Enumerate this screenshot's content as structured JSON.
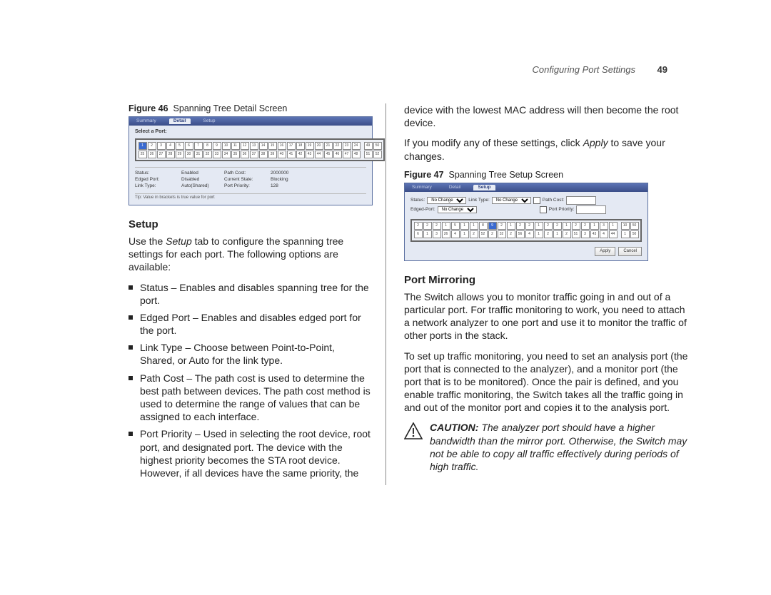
{
  "header": {
    "running_head": "Configuring Port Settings",
    "page_number": "49"
  },
  "left": {
    "fig46_label": "Figure 46",
    "fig46_title": "Spanning Tree Detail Screen",
    "detail_screen": {
      "tab_summary": "Summary",
      "tab_detail": "Detail",
      "tab_setup": "Setup",
      "select_port_label": "Select a Port:",
      "rows": {
        "status_l": "Status:",
        "status_v": "Enabled",
        "pathcost_l": "Path Cost:",
        "pathcost_v": "2000000",
        "edged_l": "Edged Port:",
        "edged_v": "Disabled",
        "curstate_l": "Current State:",
        "curstate_v": "Blocking",
        "linktype_l": "Link Type:",
        "linktype_v": "Auto(Shared)",
        "portprio_l": "Port Priority:",
        "portprio_v": "128"
      },
      "tip": "Tip: Value in brackets is true value for port"
    },
    "setup_heading": "Setup",
    "setup_intro_pre": "Use the ",
    "setup_intro_ital": "Setup",
    "setup_intro_post": " tab to configure the spanning tree settings for each port. The following options are available:",
    "bullets": [
      "Status – Enables and disables spanning tree for the port.",
      "Edged Port – Enables and disables edged port for the port.",
      "Link Type – Choose between Point-to-Point, Shared, or Auto for the link type.",
      "Path Cost – The path cost is used to determine the best path between devices. The path cost method is used to determine the range of values that can be assigned to each interface.",
      "Port Priority – Used in selecting the root device, root port, and designated port. The device with the highest priority becomes the STA root device. However, if all devices have the same priority, the"
    ]
  },
  "right": {
    "continuation": "device with the lowest MAC address will then become the root device.",
    "apply_para_pre": "If you modify any of these settings, click ",
    "apply_para_ital": "Apply",
    "apply_para_post": " to save your changes.",
    "fig47_label": "Figure 47",
    "fig47_title": "Spanning Tree Setup Screen",
    "setup_screen": {
      "tab_summary": "Summary",
      "tab_detail": "Detail",
      "tab_setup": "Setup",
      "status_l": "Status:",
      "status_opt": "No Change",
      "linktype_l": "Link Type:",
      "linktype_opt": "No Change",
      "pathcost_l": "Path Cost:",
      "edged_l": "Edged-Port:",
      "edged_opt": "No Change",
      "portprio_l": "Port Priority:",
      "apply_btn": "Apply",
      "cancel_btn": "Cancel"
    },
    "pm_heading": "Port Mirroring",
    "pm_para1": "The Switch allows you to monitor traffic going in and out of a particular port. For traffic monitoring to work, you need to attach a network analyzer to one port and use it to monitor the traffic of other ports in the stack.",
    "pm_para2": "To set up traffic monitoring, you need to set an analysis port (the port that is connected to the analyzer), and a monitor port (the port that is to be monitored). Once the pair is defined, and you enable traffic monitoring, the Switch takes all the traffic going in and out of the monitor port and copies it to the analysis port.",
    "caution_label": "CAUTION:",
    "caution_text": " The analyzer port should have a higher bandwidth than the mirror port. Otherwise, the Switch may not be able to copy all traffic effectively during periods of high traffic."
  }
}
